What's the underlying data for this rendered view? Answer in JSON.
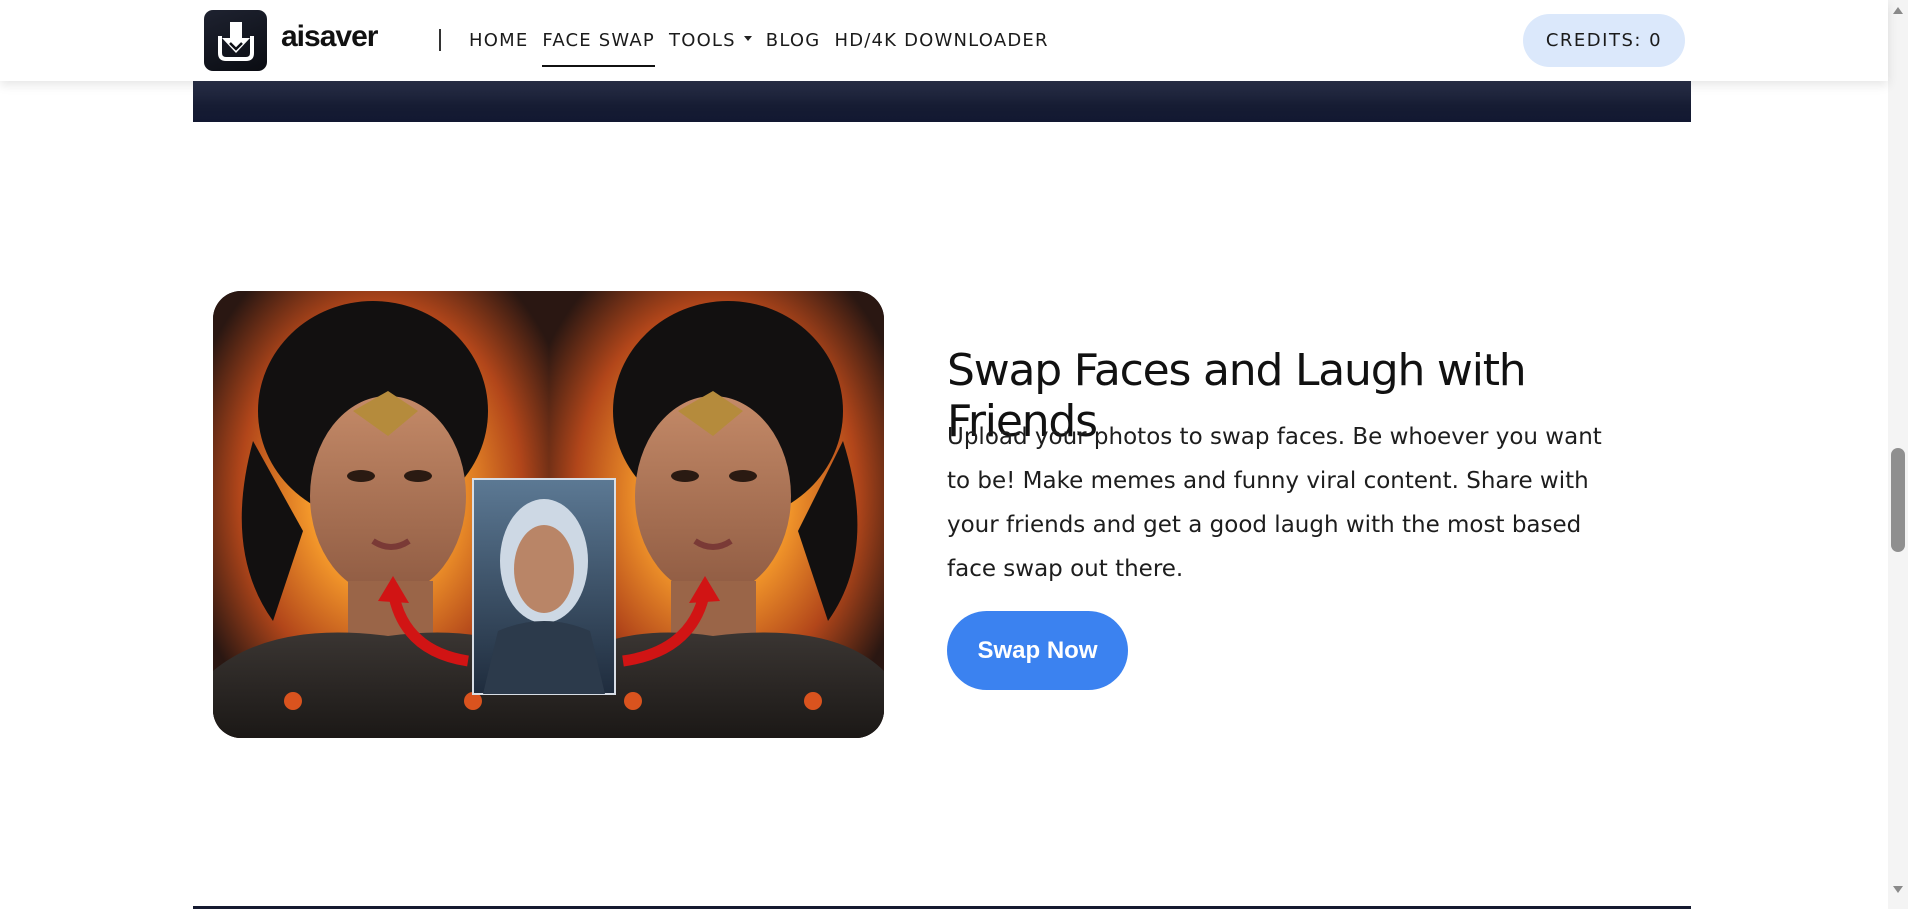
{
  "brand": {
    "name": "aisaver",
    "logo_icon": "download-arrow-icon"
  },
  "nav": {
    "items": [
      {
        "label": "HOME",
        "active": false
      },
      {
        "label": "FACE SWAP",
        "active": true
      },
      {
        "label": "TOOLS",
        "active": false,
        "has_dropdown": true
      },
      {
        "label": "BLOG",
        "active": false
      },
      {
        "label": "HD/4K DOWNLOADER",
        "active": false
      }
    ],
    "credits_label": "CREDITS: 0"
  },
  "feature": {
    "image": "face-swap-example",
    "heading": "Swap Faces and Laugh with Friends",
    "description": "Upload your photos to swap faces. Be whoever you want to be! Make memes and funny viral content. Share with your friends and get a good laugh with the most based face swap out there.",
    "cta_label": "Swap Now"
  },
  "scrollbar": {
    "position": 0.56,
    "visible_fraction": 0.12
  },
  "colors": {
    "accent": "#3b82f0",
    "credits_bg": "#dbe8fb",
    "dark_banner": "#161c33"
  }
}
